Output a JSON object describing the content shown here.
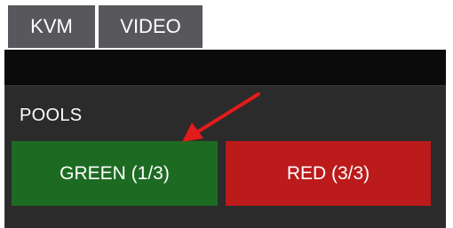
{
  "tabs": [
    {
      "label": "KVM"
    },
    {
      "label": "VIDEO"
    }
  ],
  "pools": {
    "heading": "POOLS",
    "buttons": [
      {
        "label": "GREEN (1/3)",
        "color": "#1d6b22"
      },
      {
        "label": "RED (3/3)",
        "color": "#bb1b1b"
      }
    ]
  },
  "annotation": {
    "arrow_color": "#e21b1b",
    "icon": "arrow-pointer-icon"
  }
}
